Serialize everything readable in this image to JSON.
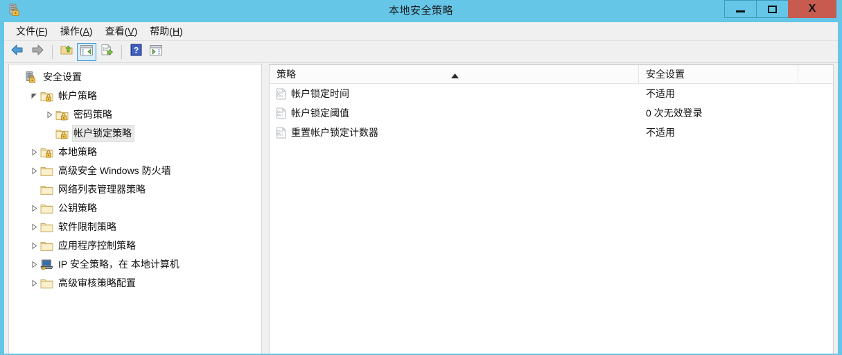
{
  "window": {
    "title": "本地安全策略",
    "app_icon": "security-settings-icon",
    "controls": {
      "minimize": "—",
      "maximize": "□",
      "close": "X"
    },
    "frame_color": "#65c6e8",
    "close_color": "#c75b50"
  },
  "menubar": {
    "items": [
      {
        "text": "文件",
        "mnemonic": "F"
      },
      {
        "text": "操作",
        "mnemonic": "A"
      },
      {
        "text": "查看",
        "mnemonic": "V"
      },
      {
        "text": "帮助",
        "mnemonic": "H"
      }
    ]
  },
  "toolbar": {
    "buttons": [
      {
        "name": "back-button",
        "icon": "back-arrow-icon"
      },
      {
        "name": "forward-button",
        "icon": "forward-arrow-icon"
      },
      {
        "name": "up-one-level-button",
        "icon": "folder-up-icon"
      },
      {
        "name": "show-hide-console-tree-button",
        "icon": "console-tree-icon",
        "active": true
      },
      {
        "name": "export-list-button",
        "icon": "export-list-icon"
      },
      {
        "name": "help-button",
        "icon": "help-question-icon"
      },
      {
        "name": "show-action-pane-button",
        "icon": "action-pane-icon"
      }
    ]
  },
  "tree": {
    "items": [
      {
        "label": "安全设置",
        "depth": 0,
        "expander": "none",
        "icon": "security-settings-icon",
        "selected": false
      },
      {
        "label": "帐户策略",
        "depth": 1,
        "expander": "expanded",
        "icon": "folder-lock-icon",
        "selected": false
      },
      {
        "label": "密码策略",
        "depth": 2,
        "expander": "collapsed",
        "icon": "folder-lock-icon",
        "selected": false
      },
      {
        "label": "帐户锁定策略",
        "depth": 2,
        "expander": "none",
        "icon": "folder-lock-icon",
        "selected": true
      },
      {
        "label": "本地策略",
        "depth": 1,
        "expander": "collapsed",
        "icon": "folder-lock-icon",
        "selected": false
      },
      {
        "label": "高级安全 Windows 防火墙",
        "depth": 1,
        "expander": "collapsed",
        "icon": "folder-icon",
        "selected": false
      },
      {
        "label": "网络列表管理器策略",
        "depth": 1,
        "expander": "none",
        "icon": "folder-icon",
        "selected": false
      },
      {
        "label": "公钥策略",
        "depth": 1,
        "expander": "collapsed",
        "icon": "folder-icon",
        "selected": false
      },
      {
        "label": "软件限制策略",
        "depth": 1,
        "expander": "collapsed",
        "icon": "folder-icon",
        "selected": false
      },
      {
        "label": "应用程序控制策略",
        "depth": 1,
        "expander": "collapsed",
        "icon": "folder-icon",
        "selected": false
      },
      {
        "label": "IP 安全策略，在 本地计算机",
        "depth": 1,
        "expander": "collapsed",
        "icon": "ip-security-icon",
        "selected": false
      },
      {
        "label": "高级审核策略配置",
        "depth": 1,
        "expander": "collapsed",
        "icon": "folder-icon",
        "selected": false
      }
    ]
  },
  "listview": {
    "columns": [
      {
        "label": "策略",
        "sorted": "asc"
      },
      {
        "label": "安全设置",
        "sorted": "none"
      },
      {
        "label": "",
        "sorted": "none"
      }
    ],
    "rows": [
      {
        "policy": "帐户锁定时间",
        "setting": "不适用",
        "icon": "policy-document-icon"
      },
      {
        "policy": "帐户锁定阈值",
        "setting": "0 次无效登录",
        "icon": "policy-document-icon"
      },
      {
        "policy": "重置帐户锁定计数器",
        "setting": "不适用",
        "icon": "policy-document-icon"
      }
    ]
  }
}
